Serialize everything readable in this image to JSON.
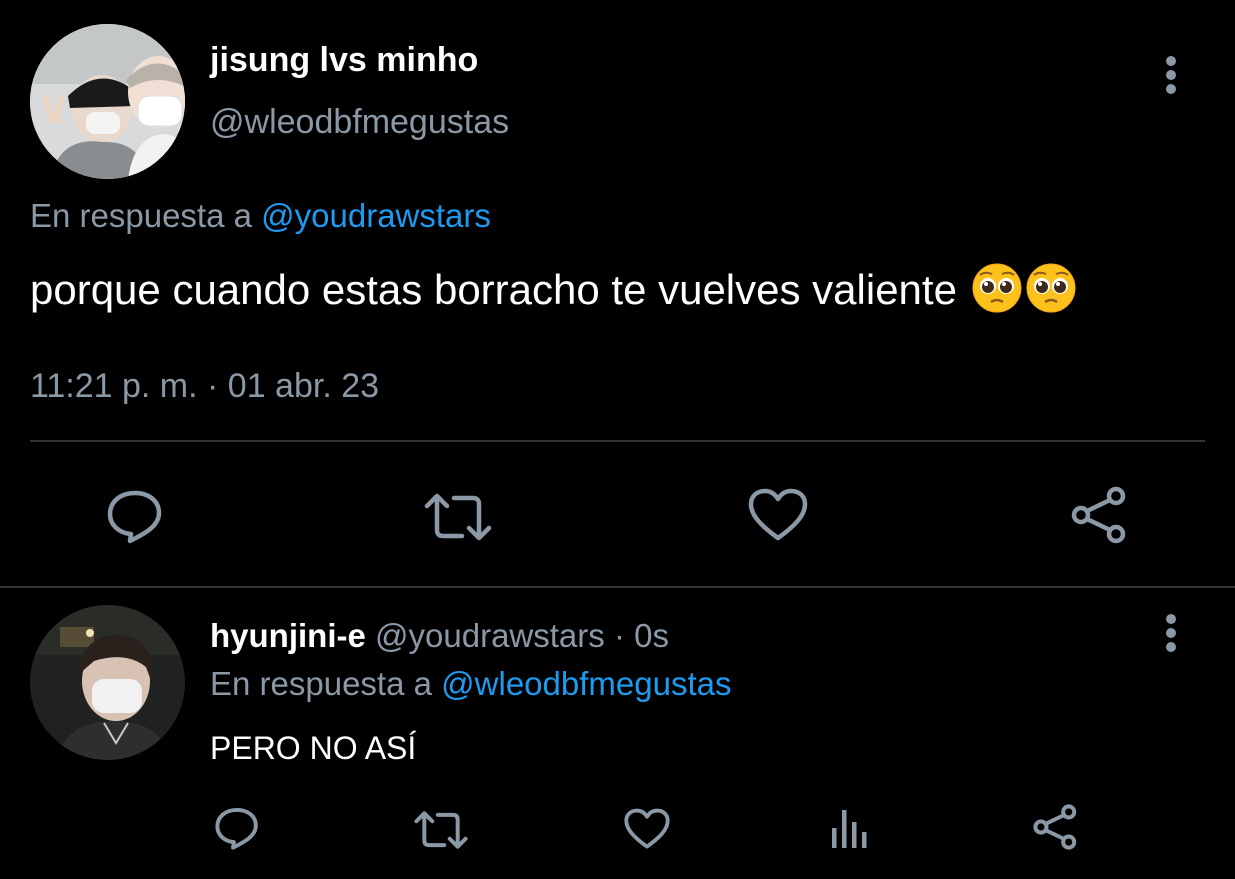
{
  "main_tweet": {
    "display_name": "jisung lvs minho",
    "handle": "@wleodbfmegustas",
    "reply_prefix": "En respuesta a",
    "reply_mention": "@youdrawstars",
    "text": "porque cuando estas borracho te vuelves valiente",
    "emojis": [
      "pleading-face-icon",
      "pleading-face-icon"
    ],
    "timestamp": "11:21 p. m. · 01 abr. 23",
    "actions": [
      "reply-icon",
      "retweet-icon",
      "like-icon",
      "share-icon"
    ]
  },
  "reply_tweet": {
    "display_name": "hyunjini-e",
    "handle": "@youdrawstars",
    "separator": "·",
    "time": "0s",
    "reply_prefix": "En respuesta a",
    "reply_mention": "@wleodbfmegustas",
    "text": "PERO NO ASÍ",
    "actions": [
      "reply-icon",
      "retweet-icon",
      "like-icon",
      "views-icon",
      "share-icon"
    ]
  },
  "colors": {
    "background": "#000000",
    "primary_text": "#ffffff",
    "secondary_text": "#8b98a5",
    "accent": "#1d9bf0",
    "divider": "#2f3336"
  }
}
